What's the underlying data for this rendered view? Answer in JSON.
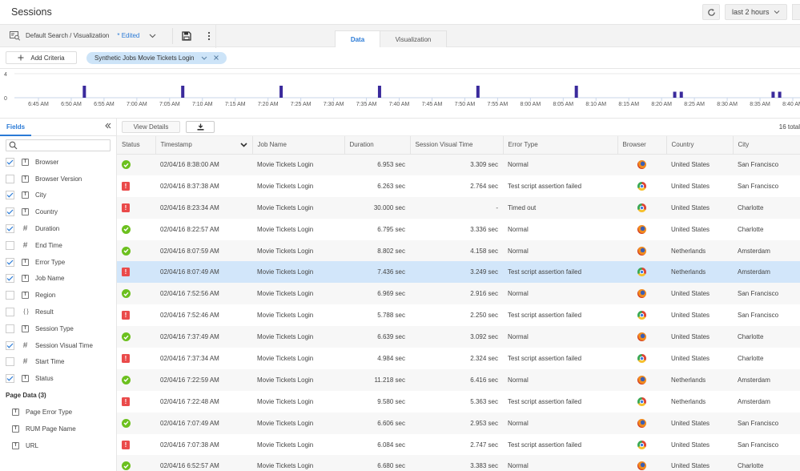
{
  "header": {
    "title": "Sessions",
    "time_range": "last 2 hours"
  },
  "toolbar": {
    "search_name": "Default Search / Visualization",
    "edited_label": "* Edited"
  },
  "tabs": [
    {
      "label": "Data",
      "active": true
    },
    {
      "label": "Visualization",
      "active": false
    }
  ],
  "criteria": {
    "add_label": "Add Criteria",
    "chips": [
      {
        "label": "Synthetic Jobs Movie Tickets Login"
      }
    ]
  },
  "chart_data": {
    "type": "bar",
    "title": "",
    "xlabel": "",
    "ylabel": "",
    "ylim": [
      0,
      4
    ],
    "y_ticks": [
      "0",
      "4"
    ],
    "x_ticks": [
      "6:45 AM",
      "6:50 AM",
      "6:55 AM",
      "7:00 AM",
      "7:05 AM",
      "7:10 AM",
      "7:15 AM",
      "7:20 AM",
      "7:25 AM",
      "7:30 AM",
      "7:35 AM",
      "7:40 AM",
      "7:45 AM",
      "7:50 AM",
      "7:55 AM",
      "8:00 AM",
      "8:05 AM",
      "8:10 AM",
      "8:15 AM",
      "8:20 AM",
      "8:25 AM",
      "8:30 AM",
      "8:35 AM",
      "8:40 AM"
    ],
    "x_range_minutes": [
      -104,
      1
    ],
    "bar_color": "#3a2a9c",
    "bars": [
      {
        "time": "6:52 AM",
        "minute": 52,
        "hour": 6,
        "value": 2
      },
      {
        "time": "7:07 AM",
        "minute": 7,
        "hour": 7,
        "value": 2
      },
      {
        "time": "7:22 AM",
        "minute": 22,
        "hour": 7,
        "value": 2
      },
      {
        "time": "7:37 AM",
        "minute": 37,
        "hour": 7,
        "value": 2
      },
      {
        "time": "7:52 AM",
        "minute": 52,
        "hour": 7,
        "value": 2
      },
      {
        "time": "8:07 AM",
        "minute": 7,
        "hour": 8,
        "value": 2
      },
      {
        "time": "8:22 AM",
        "minute": 22,
        "hour": 8,
        "value": 1
      },
      {
        "time": "8:23 AM",
        "minute": 23,
        "hour": 8,
        "value": 1
      },
      {
        "time": "8:37 AM",
        "minute": 37,
        "hour": 8,
        "value": 1
      },
      {
        "time": "8:38 AM",
        "minute": 38,
        "hour": 8,
        "value": 1
      }
    ]
  },
  "fields_panel": {
    "tab_label": "Fields",
    "search_placeholder": "",
    "fields": [
      {
        "label": "Browser",
        "type": "text",
        "checked": true
      },
      {
        "label": "Browser Version",
        "type": "text",
        "checked": false
      },
      {
        "label": "City",
        "type": "text",
        "checked": true
      },
      {
        "label": "Country",
        "type": "text",
        "checked": true
      },
      {
        "label": "Duration",
        "type": "number",
        "checked": true
      },
      {
        "label": "End Time",
        "type": "number",
        "checked": false
      },
      {
        "label": "Error Type",
        "type": "text",
        "checked": true
      },
      {
        "label": "Job Name",
        "type": "text",
        "checked": true
      },
      {
        "label": "Region",
        "type": "text",
        "checked": false
      },
      {
        "label": "Result",
        "type": "object",
        "checked": false
      },
      {
        "label": "Session Type",
        "type": "text",
        "checked": false
      },
      {
        "label": "Session Visual Time",
        "type": "number",
        "checked": true
      },
      {
        "label": "Start Time",
        "type": "number",
        "checked": false
      },
      {
        "label": "Status",
        "type": "text",
        "checked": true
      }
    ],
    "page_data_label": "Page Data (3)",
    "page_fields": [
      {
        "label": "Page Error Type",
        "type": "text"
      },
      {
        "label": "RUM Page Name",
        "type": "text"
      },
      {
        "label": "URL",
        "type": "text"
      }
    ]
  },
  "table": {
    "view_details_label": "View Details",
    "total_label": "16 total",
    "columns": [
      "Status",
      "Timestamp",
      "Job Name",
      "Duration",
      "Session Visual Time",
      "Error Type",
      "Browser",
      "Country",
      "City"
    ],
    "rows": [
      {
        "status": "ok",
        "timestamp": "02/04/16 8:38:00 AM",
        "job": "Movie Tickets Login",
        "duration": "6.953 sec",
        "visual": "3.309 sec",
        "error": "Normal",
        "browser": "firefox",
        "country": "United States",
        "city": "San Francisco"
      },
      {
        "status": "error",
        "timestamp": "02/04/16 8:37:38 AM",
        "job": "Movie Tickets Login",
        "duration": "6.263 sec",
        "visual": "2.764 sec",
        "error": "Test script assertion failed",
        "browser": "chrome",
        "country": "United States",
        "city": "San Francisco"
      },
      {
        "status": "error",
        "timestamp": "02/04/16 8:23:34 AM",
        "job": "Movie Tickets Login",
        "duration": "30.000 sec",
        "visual": "-",
        "error": "Timed out",
        "browser": "chrome",
        "country": "United States",
        "city": "Charlotte"
      },
      {
        "status": "ok",
        "timestamp": "02/04/16 8:22:57 AM",
        "job": "Movie Tickets Login",
        "duration": "6.795 sec",
        "visual": "3.336 sec",
        "error": "Normal",
        "browser": "firefox",
        "country": "United States",
        "city": "Charlotte"
      },
      {
        "status": "ok",
        "timestamp": "02/04/16 8:07:59 AM",
        "job": "Movie Tickets Login",
        "duration": "8.802 sec",
        "visual": "4.158 sec",
        "error": "Normal",
        "browser": "firefox",
        "country": "Netherlands",
        "city": "Amsterdam"
      },
      {
        "status": "error",
        "timestamp": "02/04/16 8:07:49 AM",
        "job": "Movie Tickets Login",
        "duration": "7.436 sec",
        "visual": "3.249 sec",
        "error": "Test script assertion failed",
        "browser": "chrome",
        "country": "Netherlands",
        "city": "Amsterdam",
        "selected": true
      },
      {
        "status": "ok",
        "timestamp": "02/04/16 7:52:56 AM",
        "job": "Movie Tickets Login",
        "duration": "6.969 sec",
        "visual": "2.916 sec",
        "error": "Normal",
        "browser": "firefox",
        "country": "United States",
        "city": "San Francisco"
      },
      {
        "status": "error",
        "timestamp": "02/04/16 7:52:46 AM",
        "job": "Movie Tickets Login",
        "duration": "5.788 sec",
        "visual": "2.250 sec",
        "error": "Test script assertion failed",
        "browser": "chrome",
        "country": "United States",
        "city": "San Francisco"
      },
      {
        "status": "ok",
        "timestamp": "02/04/16 7:37:49 AM",
        "job": "Movie Tickets Login",
        "duration": "6.639 sec",
        "visual": "3.092 sec",
        "error": "Normal",
        "browser": "firefox",
        "country": "United States",
        "city": "Charlotte"
      },
      {
        "status": "error",
        "timestamp": "02/04/16 7:37:34 AM",
        "job": "Movie Tickets Login",
        "duration": "4.984 sec",
        "visual": "2.324 sec",
        "error": "Test script assertion failed",
        "browser": "chrome",
        "country": "United States",
        "city": "Charlotte"
      },
      {
        "status": "ok",
        "timestamp": "02/04/16 7:22:59 AM",
        "job": "Movie Tickets Login",
        "duration": "11.218 sec",
        "visual": "6.416 sec",
        "error": "Normal",
        "browser": "firefox",
        "country": "Netherlands",
        "city": "Amsterdam"
      },
      {
        "status": "error",
        "timestamp": "02/04/16 7:22:48 AM",
        "job": "Movie Tickets Login",
        "duration": "9.580 sec",
        "visual": "5.363 sec",
        "error": "Test script assertion failed",
        "browser": "chrome",
        "country": "Netherlands",
        "city": "Amsterdam"
      },
      {
        "status": "ok",
        "timestamp": "02/04/16 7:07:49 AM",
        "job": "Movie Tickets Login",
        "duration": "6.606 sec",
        "visual": "2.953 sec",
        "error": "Normal",
        "browser": "firefox",
        "country": "United States",
        "city": "San Francisco"
      },
      {
        "status": "error",
        "timestamp": "02/04/16 7:07:38 AM",
        "job": "Movie Tickets Login",
        "duration": "6.084 sec",
        "visual": "2.747 sec",
        "error": "Test script assertion failed",
        "browser": "chrome",
        "country": "United States",
        "city": "San Francisco"
      },
      {
        "status": "ok",
        "timestamp": "02/04/16 6:52:57 AM",
        "job": "Movie Tickets Login",
        "duration": "6.680 sec",
        "visual": "3.383 sec",
        "error": "Normal",
        "browser": "firefox",
        "country": "United States",
        "city": "Charlotte"
      }
    ]
  }
}
